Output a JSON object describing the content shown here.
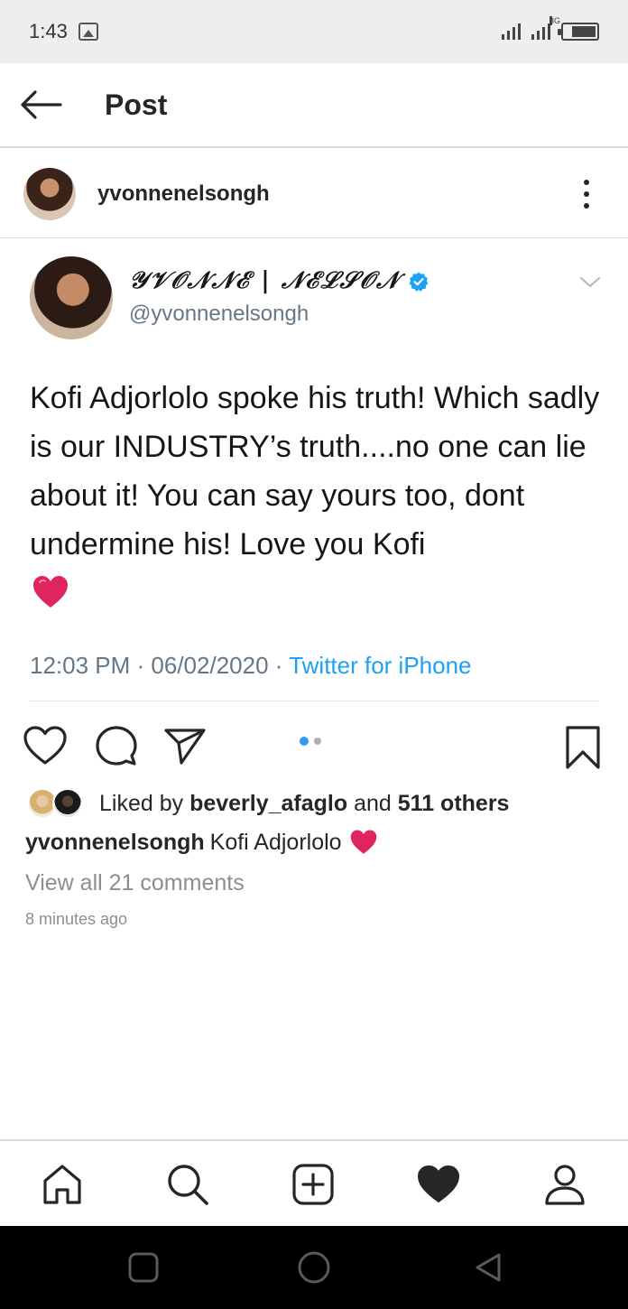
{
  "status_bar": {
    "time": "1:43",
    "network_label": "3G",
    "icons": [
      "image-icon",
      "signal-icon",
      "signal-3g-icon",
      "battery-icon"
    ]
  },
  "header": {
    "title": "Post",
    "back_icon": "arrow-left-icon"
  },
  "post": {
    "author": "yvonnenelsongh",
    "more_icon": "more-vertical-icon",
    "tweet": {
      "display_name": "𝒴𝒱𝒪𝒩𝒩ℰ | 𝒩ℰℒ𝒮𝒪𝒩",
      "handle": "@yvonnenelsongh",
      "verified": true,
      "text": "Kofi Adjorlolo spoke his truth! Which sadly is our INDUSTRY’s truth....no one can lie about it! You can say yours too, dont undermine his! Love you Kofi",
      "emoji": "❤️",
      "time": "12:03 PM",
      "date": "06/02/2020",
      "separator": " · ",
      "source": "Twitter for iPhone"
    },
    "actions": {
      "icons": [
        "heart-outline-icon",
        "comment-icon",
        "share-icon",
        "bookmark-icon"
      ],
      "carousel_index": 1,
      "carousel_count": 2
    },
    "likes": {
      "prefix": "Liked by ",
      "user": "beverly_afaglo",
      "middle": " and ",
      "others": "511 others"
    },
    "caption": {
      "user": "yvonnenelsongh",
      "text": "Kofi Adjorlolo"
    },
    "view_comments": "View all 21 comments",
    "time_ago": "8 minutes ago"
  },
  "tab_bar": {
    "items": [
      "home-icon",
      "search-icon",
      "add-post-icon",
      "activity-heart-icon",
      "profile-icon"
    ],
    "active": "activity-heart-icon"
  },
  "nav_bar": {
    "items": [
      "recents-square-icon",
      "home-circle-icon",
      "back-triangle-icon"
    ]
  },
  "colors": {
    "link_blue": "#1da1f2",
    "verified_blue": "#1da1f2",
    "muted_gray": "#8e8e8e",
    "tweet_gray": "#657786",
    "heart_red": "#e0245e",
    "carousel_active": "#3897f0"
  }
}
